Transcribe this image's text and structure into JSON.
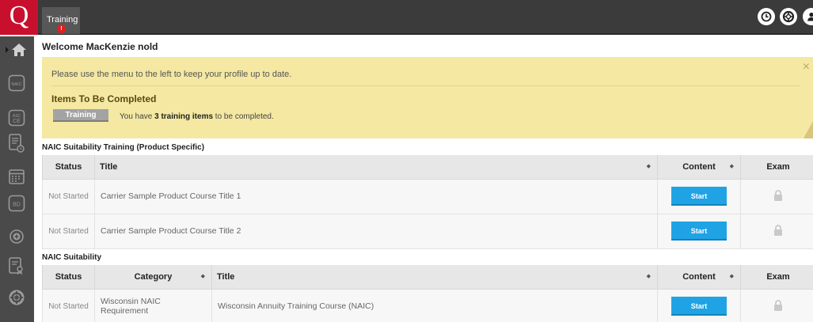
{
  "header": {
    "logo_letter": "Q",
    "tab_label": "Training",
    "tab_badge": "!",
    "icons": [
      "clock-icon",
      "lifebuoy-icon",
      "user-icon"
    ]
  },
  "sidebar": {
    "items": [
      "home-icon",
      "naic-icon",
      "asc-ce-icon",
      "document-clock-icon",
      "calendar-icon",
      "bd-icon",
      "plus-circle-icon",
      "certificate-icon",
      "support-icon"
    ]
  },
  "welcome": "Welcome MacKenzie nold",
  "notice": {
    "message": "Please use the menu to the left to keep your profile up to date.",
    "close": "×",
    "items_heading": "Items To Be Completed",
    "pill_label": "Training",
    "count_prefix": "You have ",
    "count_bold": "3 training items",
    "count_suffix": " to be completed."
  },
  "naic_product": {
    "title": "NAIC Suitability Training (Product Specific)",
    "headers": {
      "status": "Status",
      "title": "Title",
      "content": "Content",
      "exam": "Exam"
    },
    "rows": [
      {
        "status": "Not Started",
        "title": "Carrier Sample Product Course Title 1",
        "button": "Start"
      },
      {
        "status": "Not Started",
        "title": "Carrier Sample Product Course Title 2",
        "button": "Start"
      }
    ]
  },
  "naic": {
    "title": "NAIC Suitability",
    "headers": {
      "status": "Status",
      "category": "Category",
      "title": "Title",
      "content": "Content",
      "exam": "Exam"
    },
    "rows": [
      {
        "status": "Not Started",
        "category": "Wisconsin NAIC Requirement",
        "title": "Wisconsin Annuity Training Course (NAIC)",
        "button": "Start"
      }
    ]
  },
  "colors": {
    "brand": "#c8102e",
    "topbar": "#3b3b3b",
    "notice": "#f4e8a2",
    "button": "#1fa3e5"
  }
}
